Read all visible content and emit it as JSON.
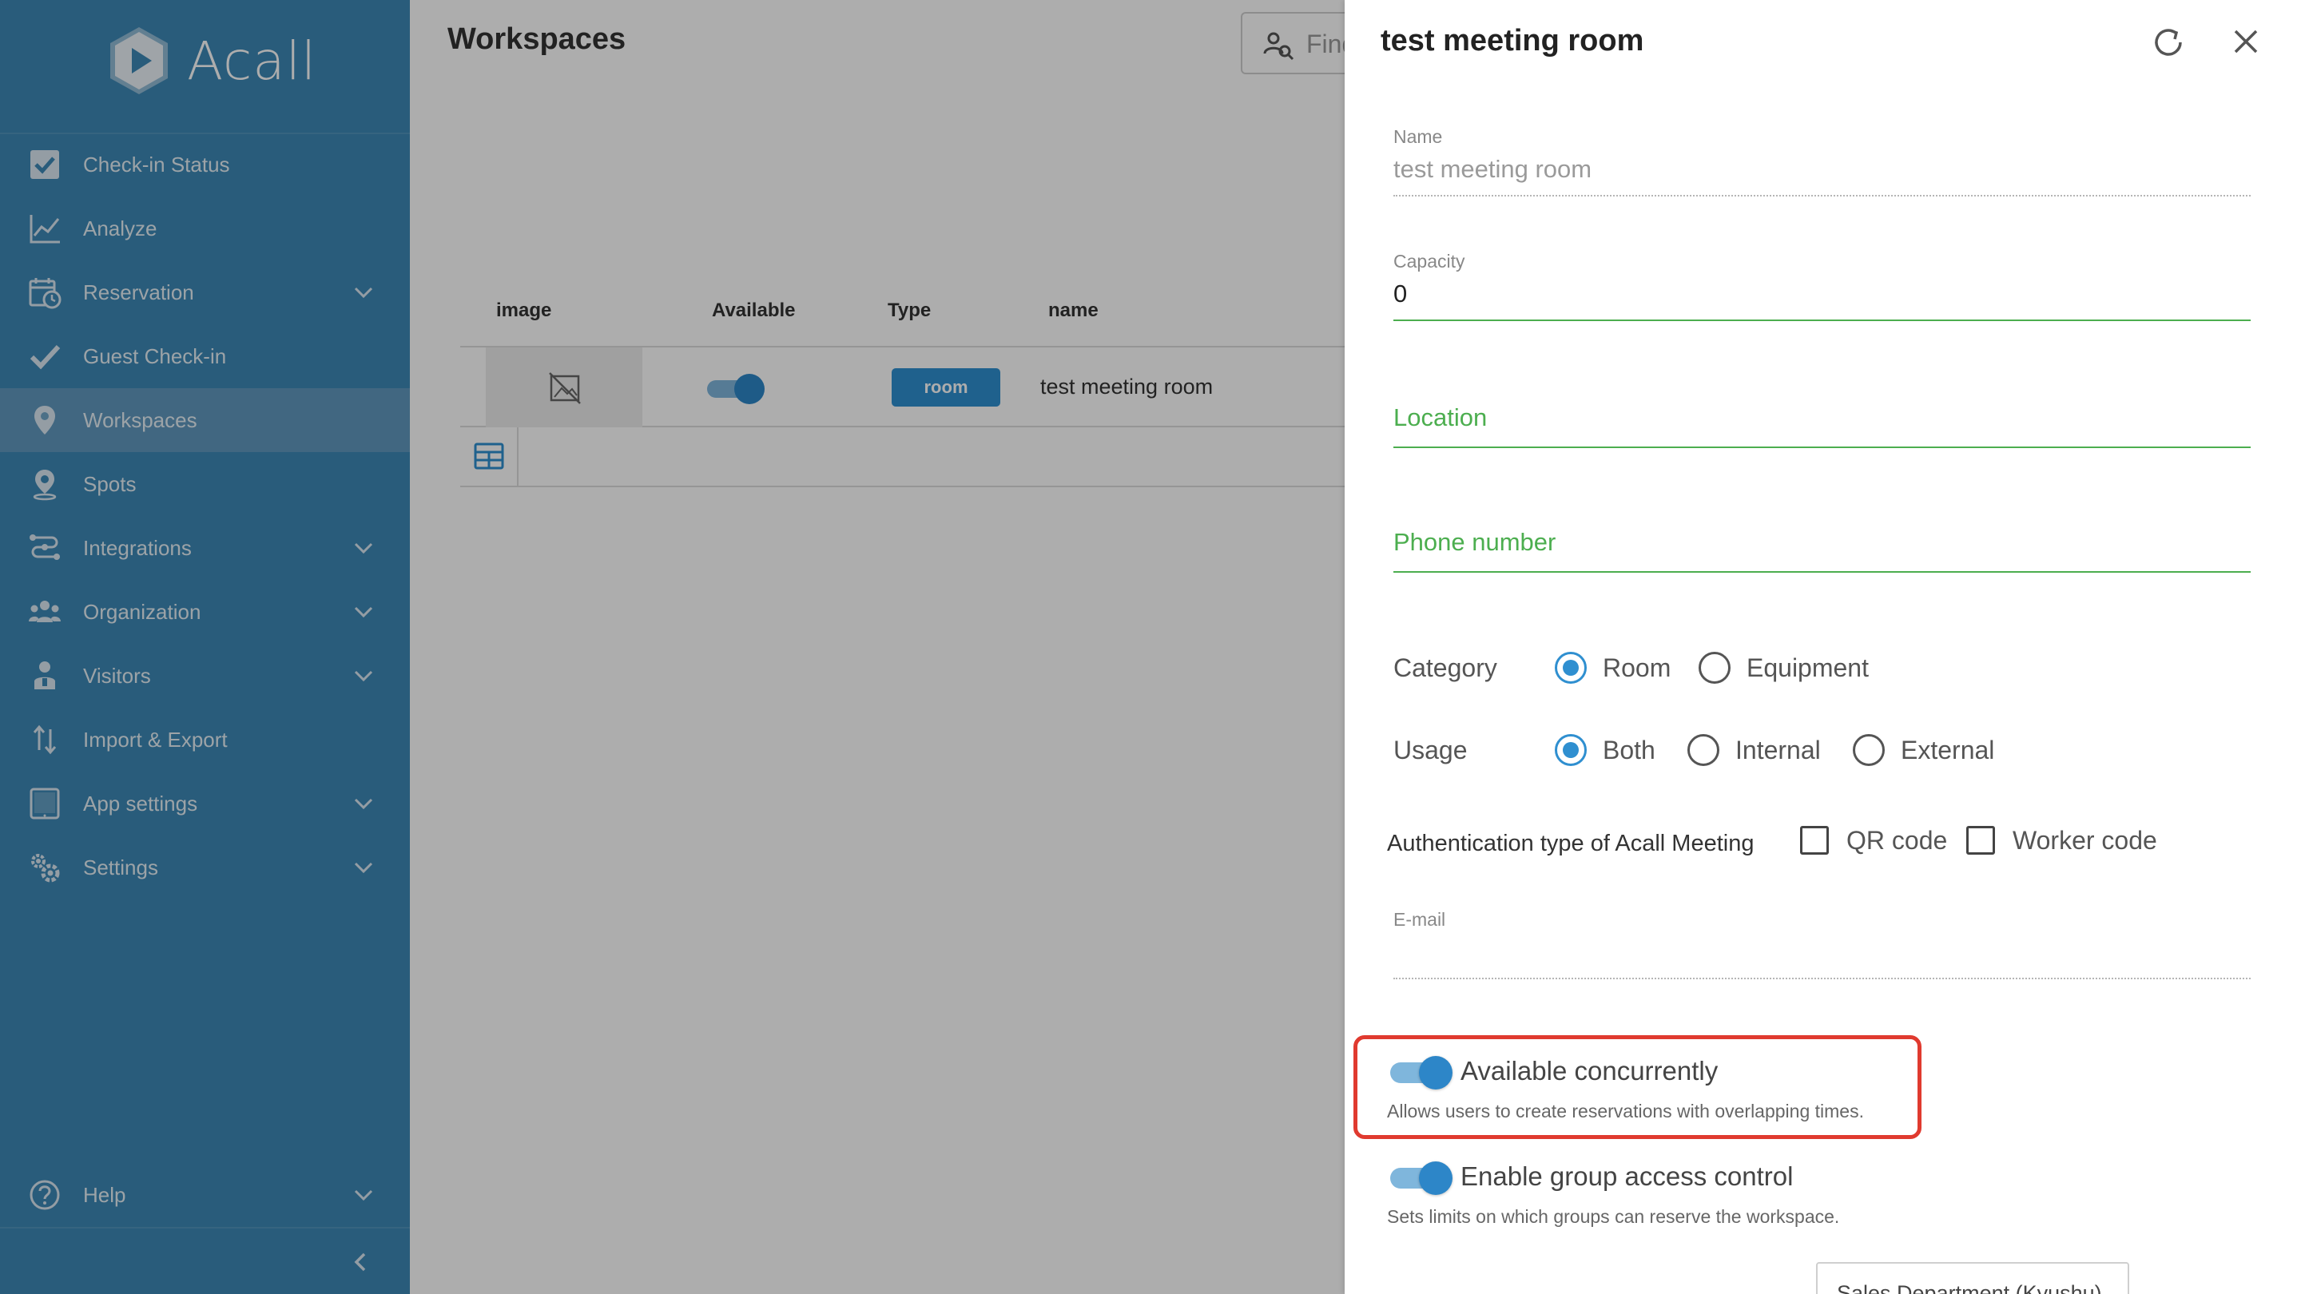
{
  "app": {
    "brand": "Acall"
  },
  "sidebar": {
    "items": [
      {
        "label": "Check-in Status",
        "icon": "checkbox-icon",
        "expandable": false,
        "active": false
      },
      {
        "label": "Analyze",
        "icon": "chart-line-icon",
        "expandable": false,
        "active": false
      },
      {
        "label": "Reservation",
        "icon": "calendar-clock-icon",
        "expandable": true,
        "active": false
      },
      {
        "label": "Guest Check-in",
        "icon": "checkmark-icon",
        "expandable": false,
        "active": false
      },
      {
        "label": "Workspaces",
        "icon": "map-pin-icon",
        "expandable": false,
        "active": true
      },
      {
        "label": "Spots",
        "icon": "location-pin-icon",
        "expandable": false,
        "active": false
      },
      {
        "label": "Integrations",
        "icon": "integrations-icon",
        "expandable": true,
        "active": false
      },
      {
        "label": "Organization",
        "icon": "people-group-icon",
        "expandable": true,
        "active": false
      },
      {
        "label": "Visitors",
        "icon": "visitor-icon",
        "expandable": true,
        "active": false
      },
      {
        "label": "Import & Export",
        "icon": "import-export-icon",
        "expandable": false,
        "active": false
      },
      {
        "label": "App settings",
        "icon": "tablet-icon",
        "expandable": true,
        "active": false
      },
      {
        "label": "Settings",
        "icon": "gears-icon",
        "expandable": true,
        "active": false
      }
    ],
    "help": {
      "label": "Help",
      "icon": "help-circle-icon"
    },
    "collapse_icon": "chevron-left-icon"
  },
  "main": {
    "title": "Workspaces",
    "search": {
      "placeholder": "Find"
    },
    "table": {
      "columns": [
        "image",
        "Available",
        "Type",
        "name"
      ],
      "rows": [
        {
          "image": "no-image-icon",
          "available": true,
          "type": "room",
          "name": "test meeting room"
        }
      ]
    }
  },
  "panel": {
    "title": "test meeting room",
    "fields": {
      "name": {
        "label": "Name",
        "value": "test meeting room"
      },
      "capacity": {
        "label": "Capacity",
        "value": "0"
      },
      "location": {
        "placeholder": "Location",
        "value": ""
      },
      "phone": {
        "placeholder": "Phone number",
        "value": ""
      },
      "email": {
        "label": "E-mail",
        "value": ""
      }
    },
    "category": {
      "label": "Category",
      "options": [
        "Room",
        "Equipment"
      ],
      "selected": "Room"
    },
    "usage": {
      "label": "Usage",
      "options": [
        "Both",
        "Internal",
        "External"
      ],
      "selected": "Both"
    },
    "auth": {
      "label": "Authentication type of Acall Meeting",
      "options": [
        {
          "label": "QR code",
          "checked": false
        },
        {
          "label": "Worker code",
          "checked": false
        }
      ]
    },
    "toggles": {
      "concurrent": {
        "title": "Available concurrently",
        "description": "Allows users to create reservations with overlapping times.",
        "on": true
      },
      "group_access": {
        "title": "Enable group access control",
        "description": "Sets limits on which groups can reserve the workspace.",
        "on": true
      }
    },
    "group_chip": "Sales Department (Kyushu)"
  },
  "colors": {
    "sidebar_bg": "#3d88b6",
    "accent_blue": "#2f8fd0",
    "green_field": "#4cae4f",
    "highlight_red": "#e03a2f"
  }
}
